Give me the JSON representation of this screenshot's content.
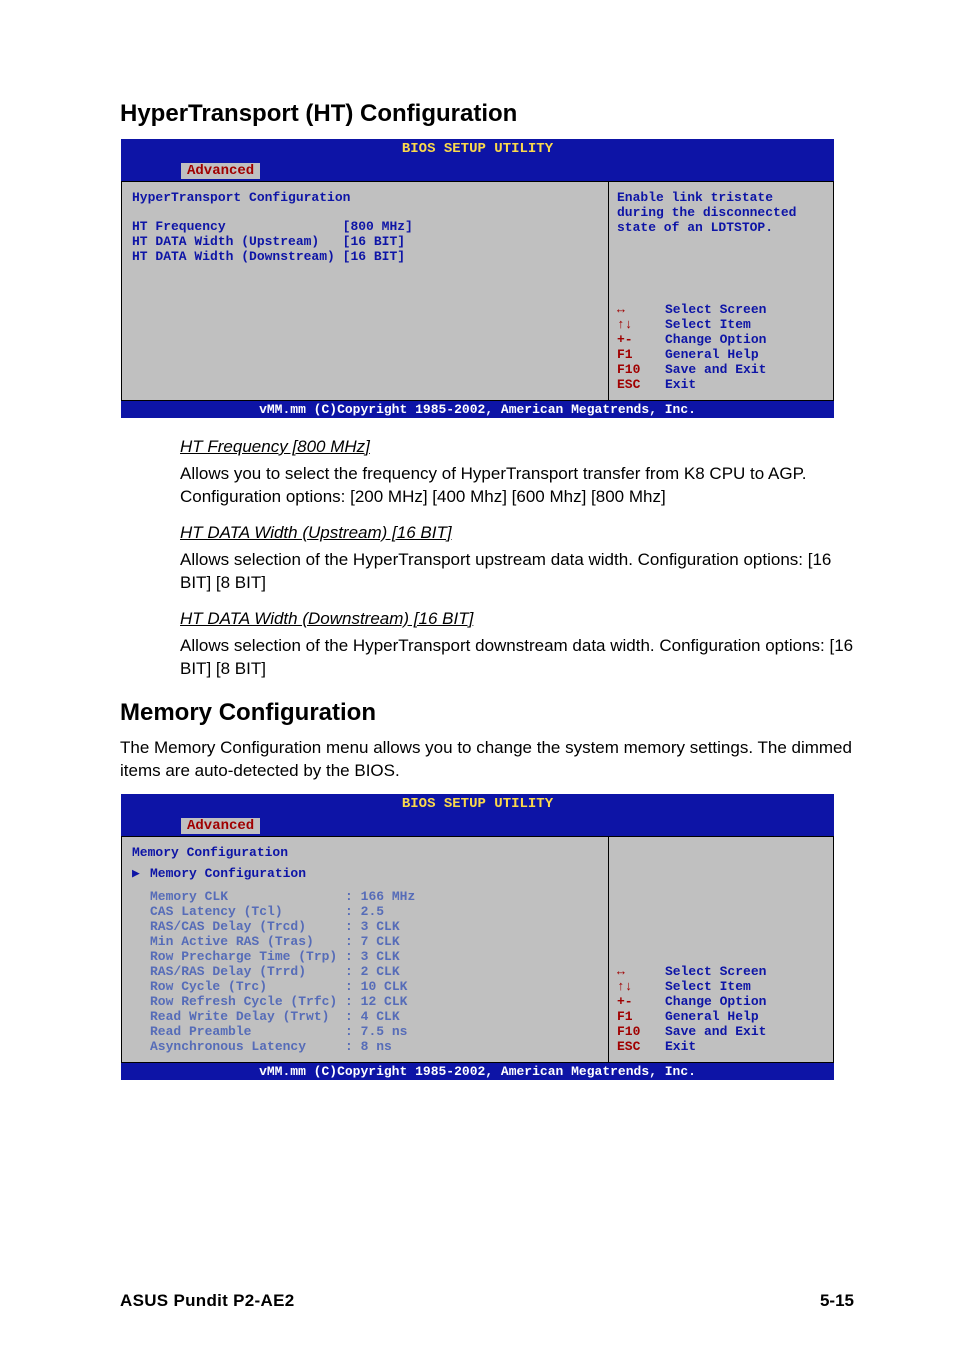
{
  "page": {
    "section1_heading": "HyperTransport (HT) Configuration",
    "section2_heading": "Memory Configuration",
    "section2_intro": "The Memory Configuration menu allows you to change the system memory settings. The dimmed items are auto-detected by the BIOS.",
    "footer_product": "ASUS Pundit P2-AE2",
    "footer_page": "5-15"
  },
  "bios_common": {
    "title": "BIOS SETUP UTILITY",
    "tab": "Advanced",
    "footer": "vMM.mm (C)Copyright 1985-2002, American Megatrends, Inc.",
    "keys": [
      {
        "sym": "↔",
        "lbl": "Select Screen"
      },
      {
        "sym": "↑↓",
        "lbl": "Select Item"
      },
      {
        "sym": "+-",
        "lbl": "Change Option"
      },
      {
        "sym": "F1",
        "lbl": "General Help"
      },
      {
        "sym": "F10",
        "lbl": "Save and Exit"
      },
      {
        "sym": "ESC",
        "lbl": "Exit"
      }
    ]
  },
  "bios1": {
    "section_title": "HyperTransport Configuration",
    "help_text": "Enable link tristate during the disconnected state of an LDTSTOP.",
    "rows": [
      {
        "label": "HT Frequency               ",
        "value": "[800 MHz]"
      },
      {
        "label": "HT DATA Width (Upstream)   ",
        "value": "[16 BIT]"
      },
      {
        "label": "HT DATA Width (Downstream) ",
        "value": "[16 BIT]"
      }
    ]
  },
  "bios2": {
    "section_title": "Memory Configuration",
    "submenu_label": "Memory Configuration",
    "rows": [
      {
        "label": "Memory CLK               : ",
        "value": "166 MHz"
      },
      {
        "label": "CAS Latency (Tcl)        : ",
        "value": "2.5"
      },
      {
        "label": "RAS/CAS Delay (Trcd)     : ",
        "value": "3 CLK"
      },
      {
        "label": "Min Active RAS (Tras)    : ",
        "value": "7 CLK"
      },
      {
        "label": "Row Precharge Time (Trp) : ",
        "value": "3 CLK"
      },
      {
        "label": "RAS/RAS Delay (Trrd)     : ",
        "value": "2 CLK"
      },
      {
        "label": "Row Cycle (Trc)          : ",
        "value": "10 CLK"
      },
      {
        "label": "Row Refresh Cycle (Trfc) : ",
        "value": "12 CLK"
      },
      {
        "label": "Read Write Delay (Trwt)  : ",
        "value": "4 CLK"
      },
      {
        "label": "Read Preamble            : ",
        "value": "7.5 ns"
      },
      {
        "label": "Asynchronous Latency     : ",
        "value": "8 ns"
      }
    ]
  },
  "items": [
    {
      "title": "HT Frequency [800 MHz]",
      "desc": "Allows you to select the frequency of HyperTransport transfer from K8 CPU to AGP. Configuration options: [200 MHz] [400 Mhz] [600 Mhz] [800 Mhz]"
    },
    {
      "title": "HT DATA Width (Upstream) [16 BIT]",
      "desc": "Allows  selection of the HyperTransport upstream data width. Configuration options: [16 BIT] [8 BIT]"
    },
    {
      "title": "HT DATA Width (Downstream) [16 BIT]",
      "desc": "Allows selection of the HyperTransport downstream data width. Configuration options: [16 BIT] [8 BIT]"
    }
  ]
}
